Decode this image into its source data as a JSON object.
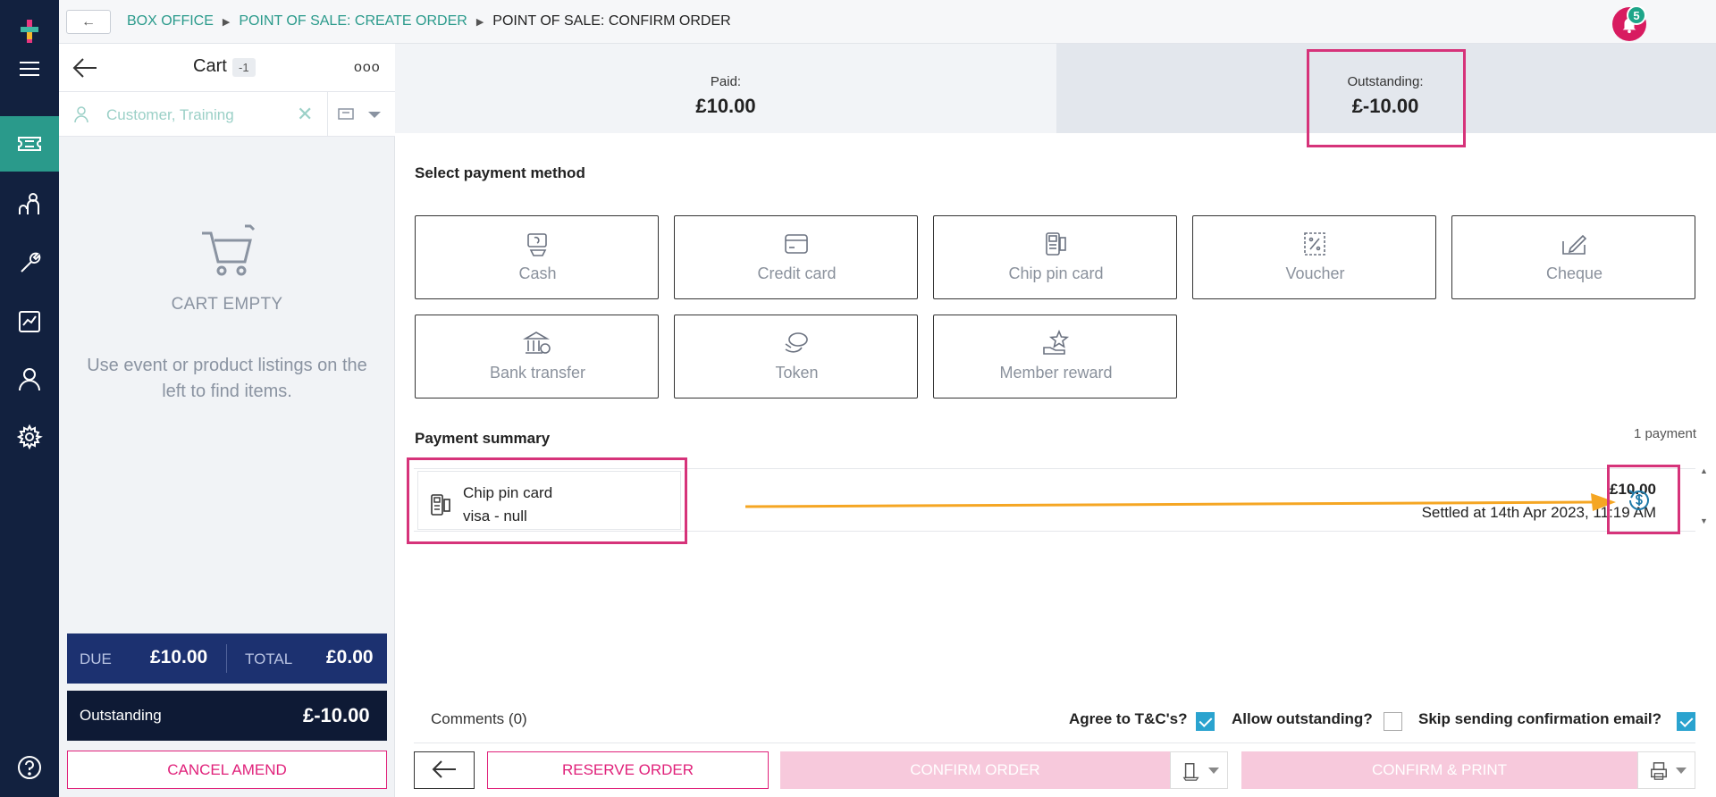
{
  "breadcrumb": {
    "back_label": "←",
    "items": [
      "BOX OFFICE",
      "POINT OF SALE: CREATE ORDER"
    ],
    "current": "POINT OF SALE: CONFIRM ORDER",
    "separator": "▶"
  },
  "notifications": {
    "count": "5"
  },
  "cart": {
    "title": "Cart",
    "count": "-1",
    "more_label": "ooo",
    "customer": "Customer, Training",
    "clear_label": "✕",
    "empty_title": "CART EMPTY",
    "empty_text": "Use event or product listings on the left to find items.",
    "due_label": "DUE",
    "due_value": "£10.00",
    "total_label": "TOTAL",
    "total_value": "£0.00",
    "outstanding_label": "Outstanding",
    "outstanding_value": "£-10.00",
    "cancel_label": "CANCEL AMEND"
  },
  "summary": {
    "paid_label": "Paid:",
    "paid_value": "£10.00",
    "outstanding_label": "Outstanding:",
    "outstanding_value": "£-10.00"
  },
  "payment_methods": {
    "title": "Select payment method",
    "items": [
      {
        "label": "Cash",
        "icon": "cash-icon"
      },
      {
        "label": "Credit card",
        "icon": "credit-card-icon"
      },
      {
        "label": "Chip pin card",
        "icon": "chip-pin-icon"
      },
      {
        "label": "Voucher",
        "icon": "voucher-icon"
      },
      {
        "label": "Cheque",
        "icon": "cheque-icon"
      },
      {
        "label": "Bank transfer",
        "icon": "bank-icon"
      },
      {
        "label": "Token",
        "icon": "token-icon"
      },
      {
        "label": "Member reward",
        "icon": "reward-icon"
      }
    ]
  },
  "payment_summary": {
    "title": "Payment summary",
    "count": "1 payment",
    "payments": [
      {
        "method": "Chip pin card",
        "detail": "visa - null",
        "amount": "£10.00",
        "settled": "Settled at 14th Apr 2023, 11:19 AM"
      }
    ]
  },
  "footer": {
    "comments": "Comments (0)",
    "agree_label": "Agree to T&C's?",
    "agree_checked": true,
    "allow_label": "Allow outstanding?",
    "allow_checked": false,
    "skip_label": "Skip sending confirmation email?",
    "skip_checked": true,
    "reserve_label": "RESERVE ORDER",
    "confirm_label": "CONFIRM ORDER",
    "print_label": "CONFIRM & PRINT"
  },
  "colors": {
    "nav": "#12213f",
    "teal": "#2a9a8b",
    "magenta": "#e0217a",
    "highlight": "#d6337a",
    "arrow": "#f5a623",
    "due_box": "#1c3170"
  }
}
